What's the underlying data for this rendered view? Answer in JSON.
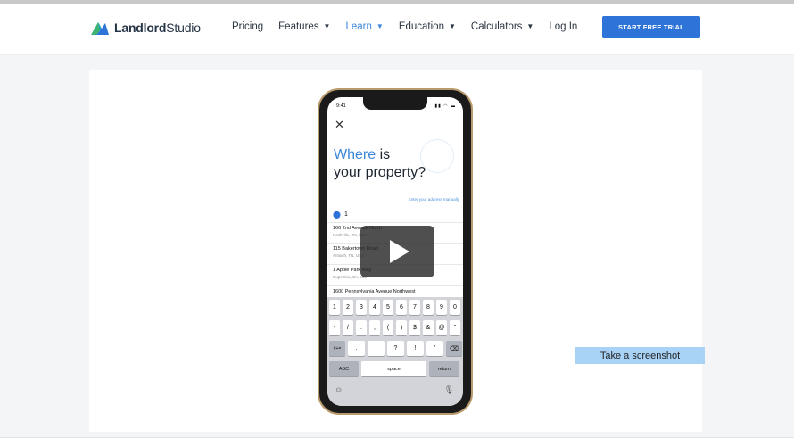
{
  "brand": {
    "name_bold": "Landlord",
    "name_light": "Studio",
    "colors": {
      "green": "#3cb371",
      "blue": "#2e73d8"
    }
  },
  "nav": {
    "items": [
      {
        "label": "Pricing",
        "dropdown": false
      },
      {
        "label": "Features",
        "dropdown": true
      },
      {
        "label": "Learn",
        "dropdown": true
      },
      {
        "label": "Education",
        "dropdown": true
      },
      {
        "label": "Calculators",
        "dropdown": true
      },
      {
        "label": "Log In",
        "dropdown": false
      }
    ],
    "cta_label": "START FREE TRIAL",
    "accent_color": "#3a86d9"
  },
  "video": {
    "phone": {
      "status_time": "9:41",
      "status_icons": "▮▮ ◠ ▬",
      "close_glyph": "✕",
      "heading_accent": "Where",
      "heading_rest_1": " is",
      "heading_line_2": "your property?",
      "manual_link": "Enter your address manually",
      "query": "1",
      "suggestions": [
        {
          "title": "166 2nd Avenue North",
          "subtitle": "Nashville, TN, USA"
        },
        {
          "title": "115 Bakertown Road",
          "subtitle": "Antioch, TN, USA"
        },
        {
          "title": "1 Apple Park Way",
          "subtitle": "Cupertino, CA, USA"
        },
        {
          "title": "1600 Pennsylvania Avenue Northwest",
          "subtitle": ""
        }
      ],
      "keyboard": {
        "row1": [
          "1",
          "2",
          "3",
          "4",
          "5",
          "6",
          "7",
          "8",
          "9",
          "0"
        ],
        "row2": [
          "-",
          "/",
          ":",
          ";",
          "(",
          ")",
          "$",
          "&",
          "@",
          "\""
        ],
        "row3": [
          "#+=",
          ".",
          ",",
          "?",
          "!",
          "'",
          "⌫"
        ],
        "abc": "ABC",
        "space": "space",
        "return": "return",
        "emoji": "☺",
        "mic": "🎙"
      }
    },
    "play_icon": "play-icon"
  },
  "tooltip": {
    "label": "Take a screenshot"
  }
}
